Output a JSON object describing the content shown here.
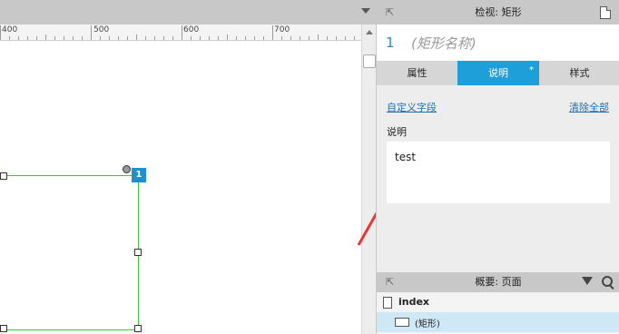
{
  "ruler": {
    "labels": [
      "400",
      "500",
      "600",
      "700",
      "80"
    ]
  },
  "canvas": {
    "shape_badge": "1"
  },
  "inspector": {
    "title": "检视: 矩形",
    "shape_number": "1",
    "shape_name_placeholder": "(矩形名称)",
    "tabs": [
      {
        "label": "属性",
        "active": false
      },
      {
        "label": "说明",
        "active": true,
        "marker": "*"
      },
      {
        "label": "样式",
        "active": false
      }
    ],
    "custom_fields_link": "自定义字段",
    "clear_all_link": "清除全部",
    "notes_label": "说明",
    "notes_value": "test"
  },
  "outline": {
    "title": "概要: 页面",
    "items": [
      {
        "label": "index",
        "type": "page"
      },
      {
        "label": "(矩形)",
        "type": "rectangle",
        "selected": true
      }
    ]
  },
  "colors": {
    "accent": "#1f9fd9",
    "selection": "#37c837",
    "arrow": "#e53935"
  },
  "icons": [
    "pin-icon",
    "page-icon",
    "filter-icon",
    "search-icon",
    "rectangle-icon",
    "dropdown-arrow-icon"
  ]
}
